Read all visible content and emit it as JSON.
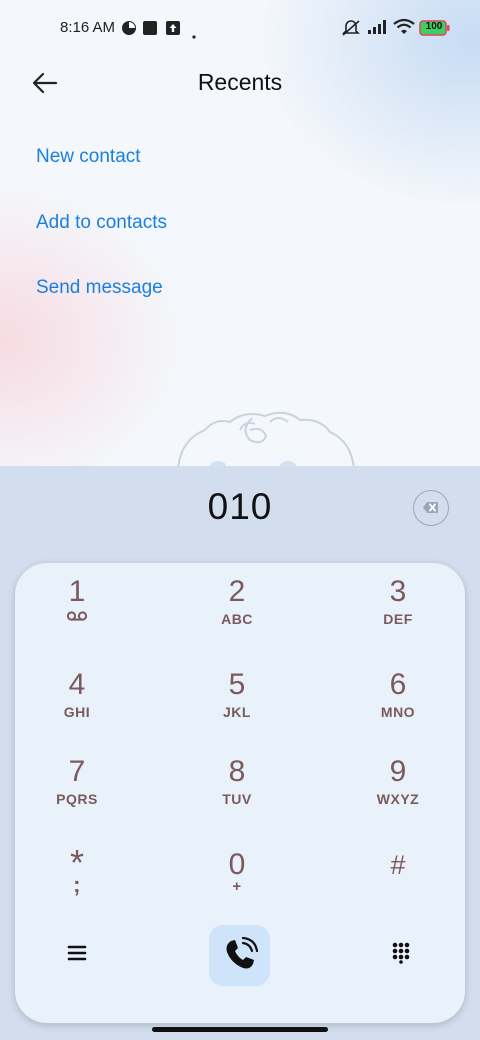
{
  "status_bar": {
    "time": "8:16 AM",
    "battery": "100",
    "icons": [
      "data-saver-icon",
      "square-notification-icon",
      "upload-notification-icon",
      "dot-icon",
      "silent-icon",
      "signal-icon",
      "wifi-icon",
      "battery-icon"
    ]
  },
  "header": {
    "title": "Recents",
    "back_icon": "arrow-left-icon"
  },
  "actions": [
    {
      "label": "New contact"
    },
    {
      "label": "Add to contacts"
    },
    {
      "label": "Send message"
    }
  ],
  "dialer": {
    "number": "010",
    "keys": [
      {
        "digit": "1",
        "letters": ""
      },
      {
        "digit": "2",
        "letters": "ABC"
      },
      {
        "digit": "3",
        "letters": "DEF"
      },
      {
        "digit": "4",
        "letters": "GHI"
      },
      {
        "digit": "5",
        "letters": "JKL"
      },
      {
        "digit": "6",
        "letters": "MNO"
      },
      {
        "digit": "7",
        "letters": "PQRS"
      },
      {
        "digit": "8",
        "letters": "TUV"
      },
      {
        "digit": "9",
        "letters": "WXYZ"
      },
      {
        "digit": "*",
        "letters": ";"
      },
      {
        "digit": "0",
        "letters": "+"
      },
      {
        "digit": "#",
        "letters": ""
      }
    ],
    "bottom_icons": [
      "menu-icon",
      "phone-icon",
      "keypad-icon"
    ]
  },
  "colors": {
    "accent": "#1a7fe0",
    "key_text": "#7a5a5a",
    "dialer_bg": "#d2deee",
    "keypad_bg": "#e9f1fb"
  }
}
